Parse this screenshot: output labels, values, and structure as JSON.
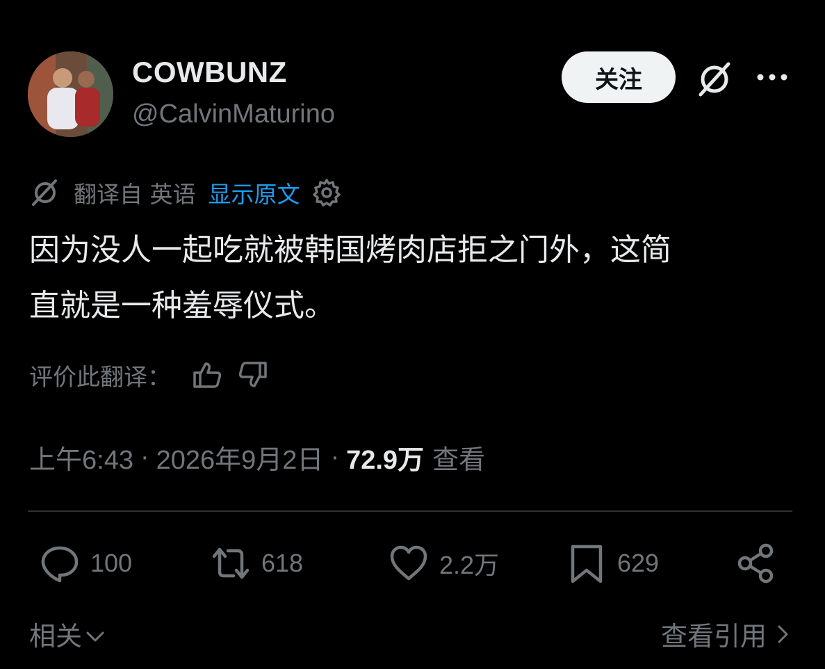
{
  "author": {
    "display_name": "COWBUNZ",
    "handle": "@CalvinMaturino"
  },
  "header": {
    "follow_label": "关注",
    "grok_icon": "grok-icon",
    "more_icon": "more-icon"
  },
  "translation": {
    "label": "翻译自 英语",
    "show_original": "显示原文"
  },
  "tweet": {
    "line1": "因为没人一起吃就被韩国烤肉店拒之门外，这简",
    "line2": "直就是一种羞辱仪式。"
  },
  "rate": {
    "label": "评价此翻译："
  },
  "meta": {
    "time": "上午6:43",
    "date": "2026年9月2日",
    "views_count": "72.9万",
    "views_label": "查看",
    "separator": "·"
  },
  "actions": {
    "replies": "100",
    "reposts": "618",
    "likes": "2.2万",
    "bookmarks": "629"
  },
  "footer": {
    "related": "相关",
    "view_quotes": "查看引用"
  },
  "colors": {
    "background": "#000000",
    "text": "#e7e9ea",
    "muted": "#71767b",
    "link": "#1d9bf0"
  }
}
